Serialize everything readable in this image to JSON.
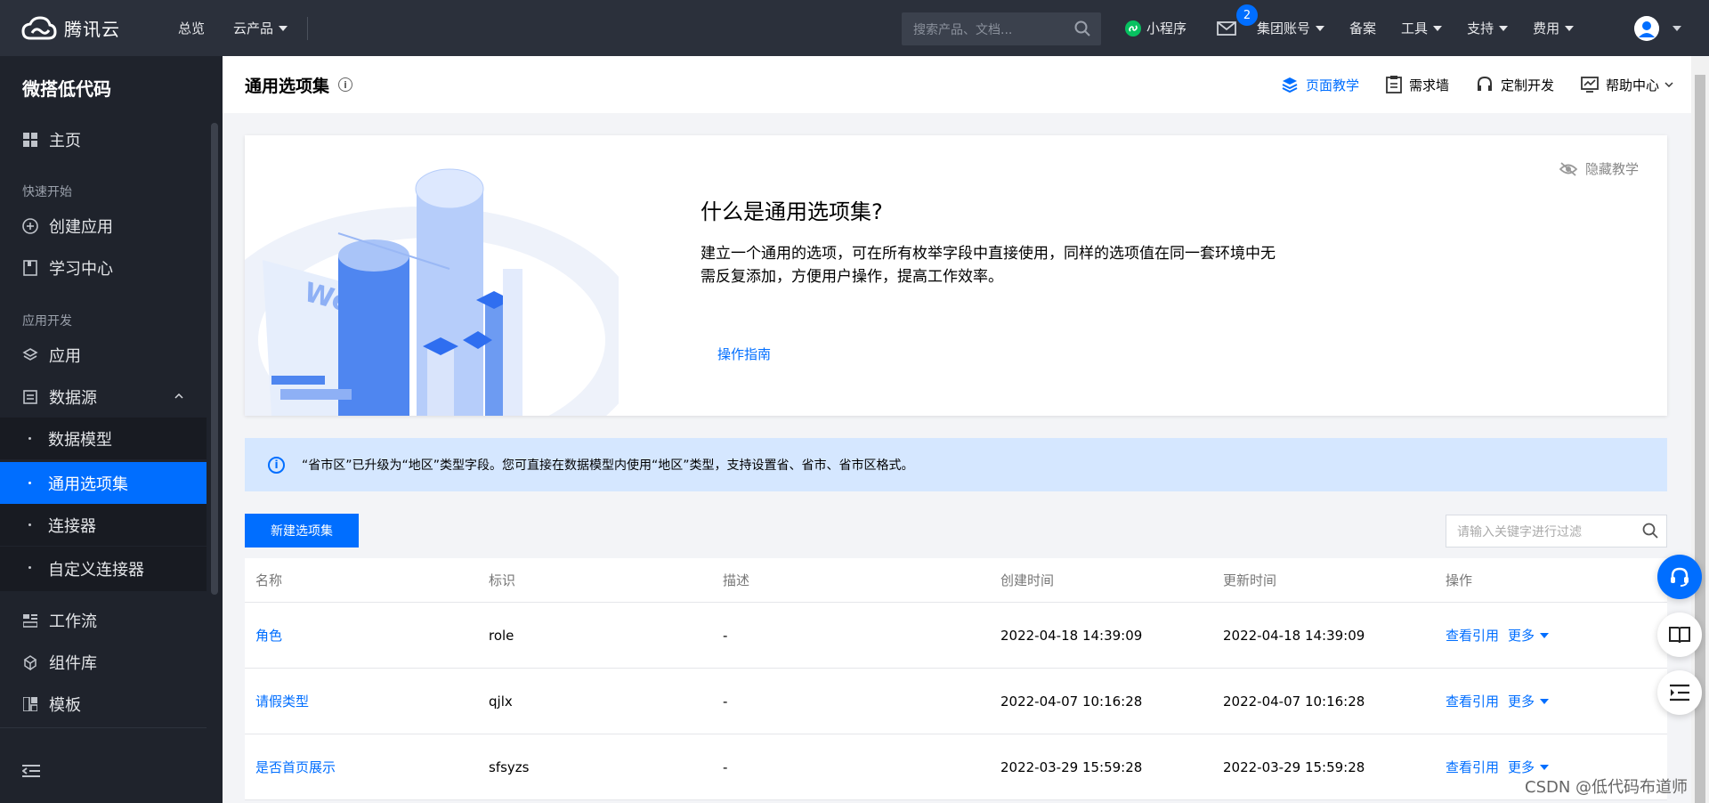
{
  "topbar": {
    "brand": "腾讯云",
    "nav": [
      "总览",
      "云产品"
    ],
    "search_placeholder": "搜索产品、文档...",
    "mini_program": "小程序",
    "message_badge": "2",
    "group_account": "集团账号",
    "beian": "备案",
    "tools": "工具",
    "support": "支持",
    "fees": "费用"
  },
  "sidebar": {
    "title": "微搭低代码",
    "home": "主页",
    "group_quickstart": "快速开始",
    "create_app": "创建应用",
    "learn_center": "学习中心",
    "group_dev": "应用开发",
    "apps": "应用",
    "datasource": "数据源",
    "data_model": "数据模型",
    "common_options": "通用选项集",
    "connector": "连接器",
    "custom_connector": "自定义连接器",
    "workflow": "工作流",
    "component_lib": "组件库",
    "template": "模板"
  },
  "header": {
    "title": "通用选项集",
    "page_tutorial": "页面教学",
    "requirement_wall": "需求墙",
    "custom_dev": "定制开发",
    "help_center": "帮助中心"
  },
  "tutorial": {
    "title": "什么是通用选项集?",
    "desc": "建立一个通用的选项，可在所有枚举字段中直接使用，同样的选项值在同一套环境中无需反复添加，方便用户操作，提高工作效率。",
    "guide_link": "操作指南",
    "hide": "隐藏教学",
    "illustration_text": "WeDa"
  },
  "notice": {
    "text": "“省市区”已升级为“地区”类型字段。您可直接在数据模型内使用“地区”类型，支持设置省、省市、省市区格式。"
  },
  "toolbar": {
    "new_button": "新建选项集",
    "filter_placeholder": "请输入关键字进行过滤"
  },
  "table": {
    "columns": [
      "名称",
      "标识",
      "描述",
      "创建时间",
      "更新时间",
      "操作"
    ],
    "rows": [
      {
        "name": "角色",
        "id": "role",
        "desc": "-",
        "created": "2022-04-18 14:39:09",
        "updated": "2022-04-18 14:39:09"
      },
      {
        "name": "请假类型",
        "id": "qjlx",
        "desc": "-",
        "created": "2022-04-07 10:16:28",
        "updated": "2022-04-07 10:16:28"
      },
      {
        "name": "是否首页展示",
        "id": "sfsyzs",
        "desc": "-",
        "created": "2022-03-29 15:59:28",
        "updated": "2022-03-29 15:59:28"
      }
    ],
    "op_view": "查看引用",
    "op_more": "更多"
  },
  "watermark": "CSDN @低代码布道师",
  "colors": {
    "accent": "#006eff",
    "sidebar_bg": "#1f232c",
    "topbar_bg": "#2b303b"
  }
}
